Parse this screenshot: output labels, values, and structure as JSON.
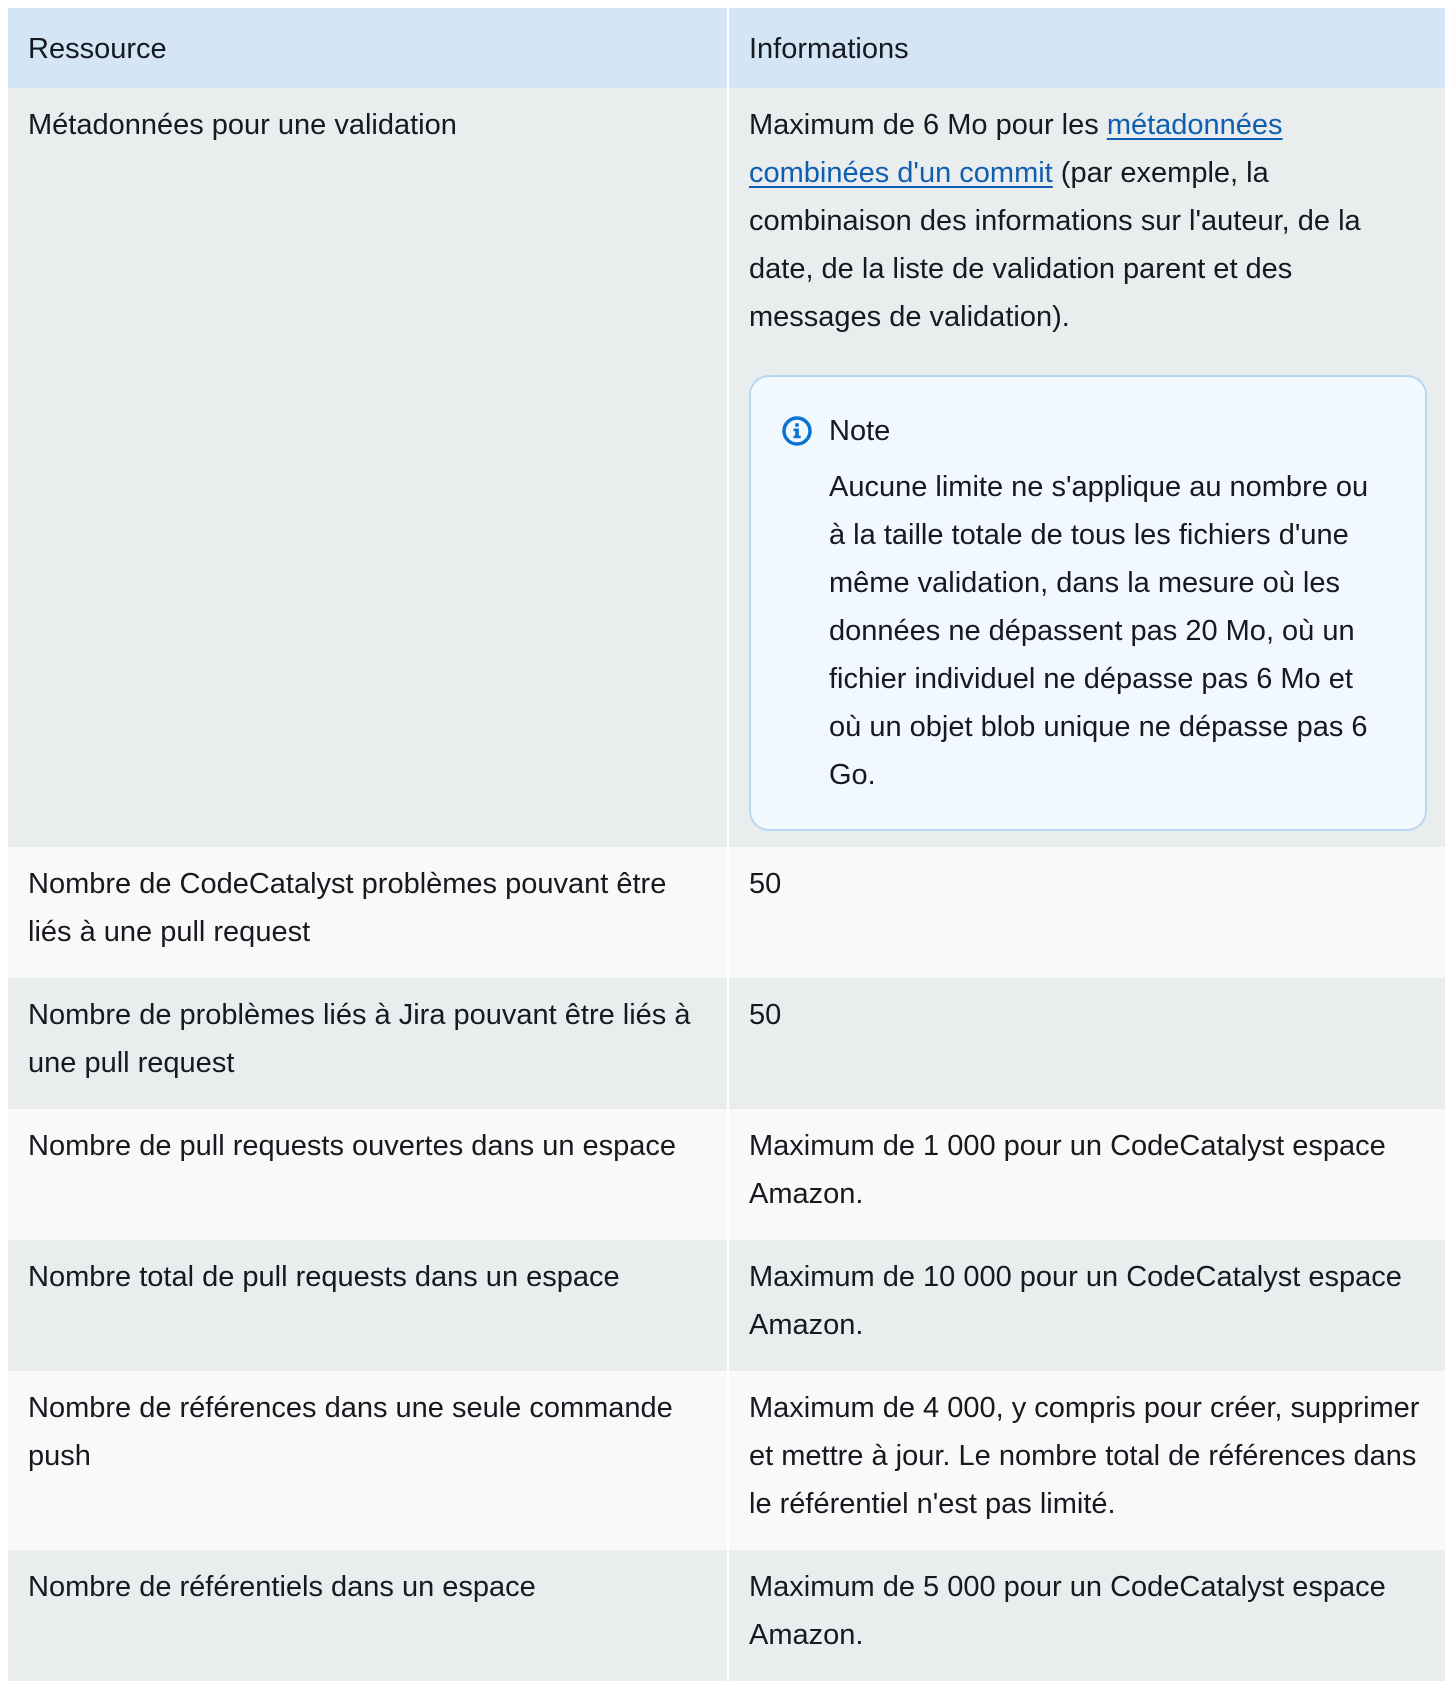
{
  "table": {
    "headers": [
      "Ressource",
      "Informations"
    ],
    "rows": [
      {
        "resource": "Métadonnées pour une validation",
        "info_before": "Maximum de 6 Mo pour les ",
        "info_link": "métadonnées combinées d'un commit",
        "info_after": " (par exemple, la combinaison des informations sur l'auteur, de la date, de la liste de validation parent et des messages de validation).",
        "note": {
          "title": "Note",
          "icon": "info-icon",
          "body": "Aucune limite ne s'applique au nombre ou à la taille totale de tous les fichiers d'une même validation, dans la mesure où les données ne dépassent pas 20 Mo, où un fichier individuel ne dépasse pas 6 Mo et où un objet blob unique ne dépasse pas 6 Go."
        }
      },
      {
        "resource": "Nombre de CodeCatalyst problèmes pouvant être liés à une pull request",
        "info": "50"
      },
      {
        "resource": "Nombre de problèmes liés à Jira pouvant être liés à une pull request",
        "info": "50"
      },
      {
        "resource": "Nombre de pull requests ouvertes dans un espace",
        "info": "Maximum de 1 000 pour un CodeCatalyst espace Amazon."
      },
      {
        "resource": "Nombre total de pull requests dans un espace",
        "info": "Maximum de 10 000 pour un CodeCatalyst espace Amazon."
      },
      {
        "resource": "Nombre de références dans une seule commande push",
        "info": "Maximum de 4 000, y compris pour créer, supprimer et mettre à jour. Le nombre total de références dans le référentiel n'est pas limité."
      },
      {
        "resource": "Nombre de référentiels dans un espace",
        "info": "Maximum de 5 000 pour un CodeCatalyst espace Amazon."
      }
    ]
  },
  "colors": {
    "header_bg": "#d4e6f6",
    "row_odd_bg": "#eaeded",
    "row_even_bg": "#f9f9f9",
    "link": "#0f5eb1",
    "note_bg": "#f1f8fe",
    "note_border": "#b8d7f3",
    "info_icon": "#0972d3"
  }
}
